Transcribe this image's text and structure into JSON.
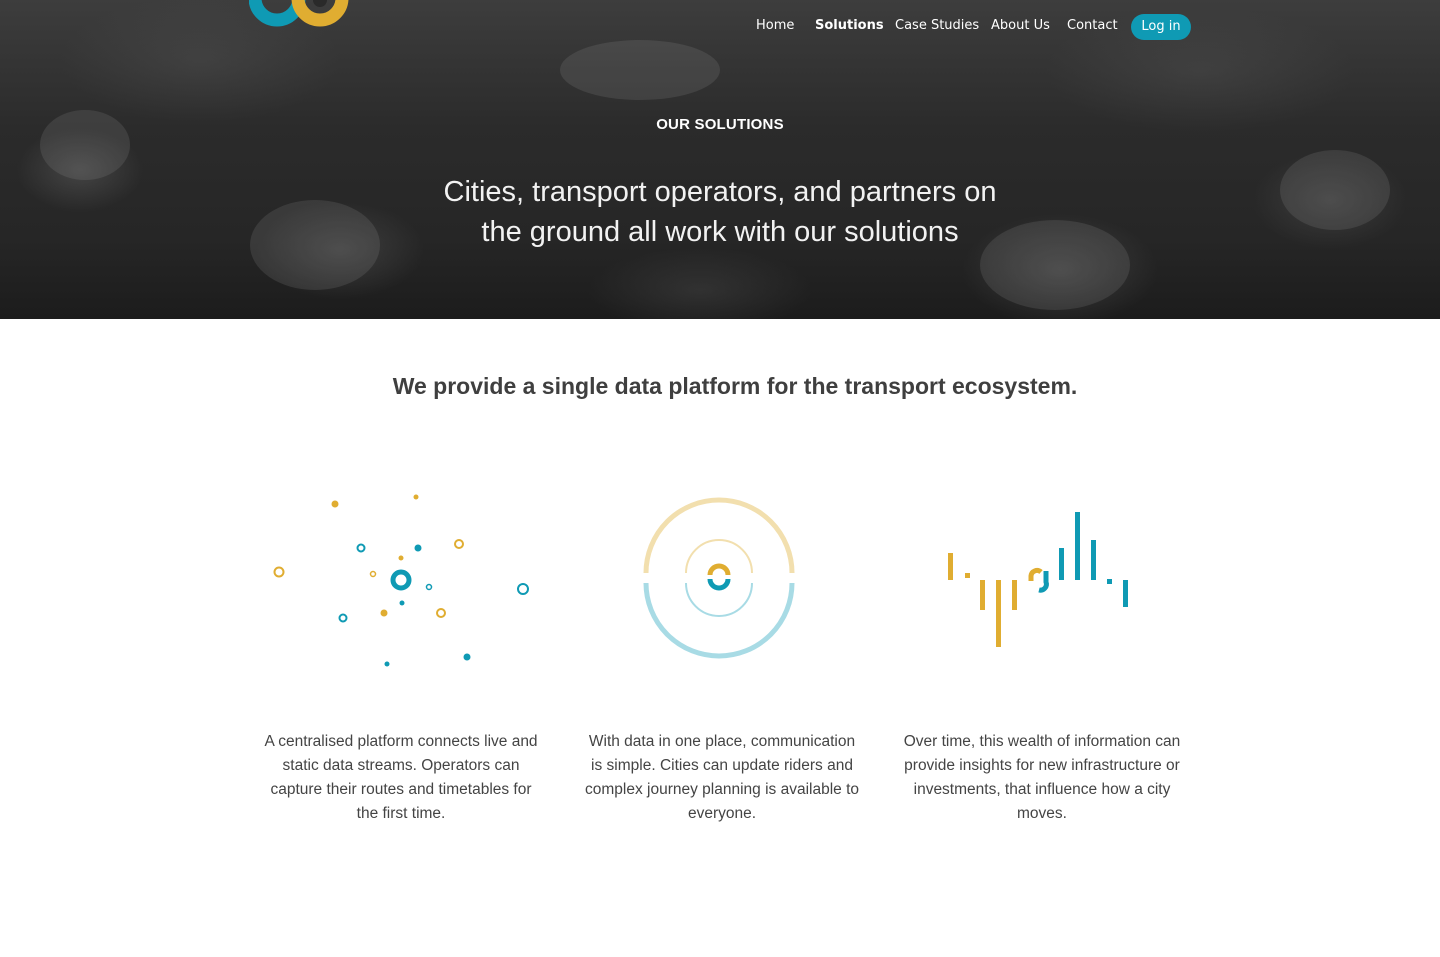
{
  "colors": {
    "teal": "#0f9ab4",
    "gold": "#e0ad31",
    "light_teal": "#a8dbe5",
    "light_gold": "#f2dfae"
  },
  "nav": {
    "items": [
      {
        "label": "Home"
      },
      {
        "label": "Solutions"
      },
      {
        "label": "Case Studies"
      },
      {
        "label": "About Us"
      },
      {
        "label": "Contact"
      }
    ],
    "login_label": "Log in"
  },
  "hero": {
    "eyebrow": "OUR SOLUTIONS",
    "title": "Cities, transport operators, and partners on the ground all work with our solutions"
  },
  "tagline": "We provide a single data platform for the transport ecosystem.",
  "columns": [
    {
      "icon": "network-dots-icon",
      "text": "A centralised platform connects live and static data streams. Operators can capture their routes and timetables for the first time."
    },
    {
      "icon": "concentric-rings-icon",
      "text": "With data in one place, communication is simple. Cities can update riders and complex journey planning is available to everyone."
    },
    {
      "icon": "bar-insights-icon",
      "text": "Over time, this wealth of information can provide insights for new infrastructure or investments, that influence how a city moves."
    }
  ]
}
